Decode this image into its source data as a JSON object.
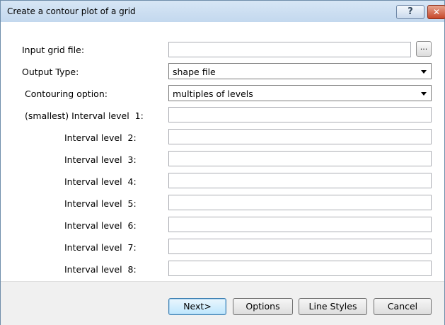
{
  "dialog": {
    "title": "Create a contour plot of a grid",
    "help_glyph": "?",
    "close_glyph": "✕"
  },
  "form": {
    "input_grid_label": "Input grid file:",
    "input_grid_value": "",
    "browse_label": "...",
    "output_type_label": "Output Type:",
    "output_type_value": "shape file",
    "contouring_label": "Contouring option:",
    "contouring_value": "multiples of levels",
    "levels": [
      {
        "label": "(smallest) Interval level  1:",
        "value": ""
      },
      {
        "label": "Interval level  2:",
        "value": ""
      },
      {
        "label": "Interval level  3:",
        "value": ""
      },
      {
        "label": "Interval level  4:",
        "value": ""
      },
      {
        "label": "Interval level  5:",
        "value": ""
      },
      {
        "label": "Interval level  6:",
        "value": ""
      },
      {
        "label": "Interval level  7:",
        "value": ""
      },
      {
        "label": "Interval level  8:",
        "value": ""
      }
    ]
  },
  "buttons": {
    "next": "Next>",
    "options": "Options",
    "line_styles": "Line Styles",
    "cancel": "Cancel"
  }
}
